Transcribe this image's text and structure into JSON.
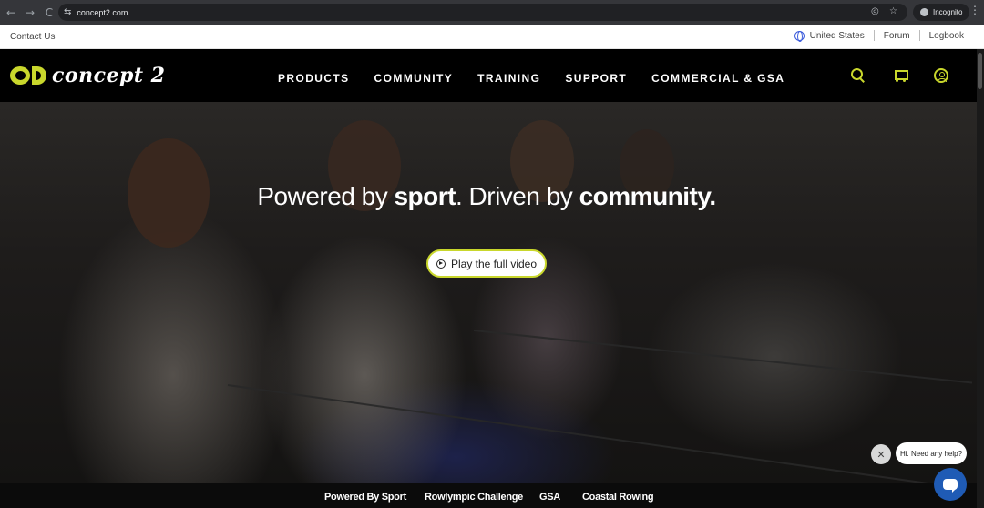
{
  "browser": {
    "url": "concept2.com",
    "back_icon": "←",
    "forward_icon": "→",
    "reload_icon": "C",
    "tune_icon": "⇆",
    "incognito_label": "Incognito",
    "kebab_icon": "⋮",
    "eye_off_icon": "◎",
    "star_icon": "☆"
  },
  "utility": {
    "contact": "Contact Us",
    "region": "United States",
    "forum": "Forum",
    "logbook": "Logbook"
  },
  "header": {
    "logo_text": "concept 2",
    "nav": [
      "PRODUCTS",
      "COMMUNITY",
      "TRAINING",
      "SUPPORT",
      "COMMERCIAL & GSA"
    ],
    "accent_color": "#c9d72c"
  },
  "hero": {
    "title_part1": "Powered by ",
    "title_bold1": "sport",
    "title_part2": ". Driven by ",
    "title_bold2": "community.",
    "play_label": "Play the full video"
  },
  "subnav": [
    "Powered By Sport",
    "Rowlympic Challenge",
    "GSA",
    "Coastal Rowing"
  ],
  "chat": {
    "close_icon": "✕",
    "prompt": "Hi. Need any help?"
  }
}
